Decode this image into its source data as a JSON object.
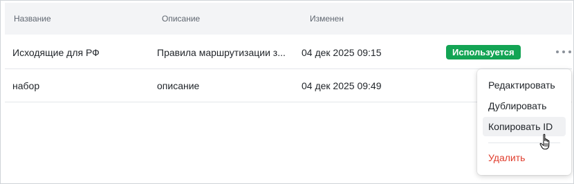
{
  "table": {
    "columns": [
      "Название",
      "Описание",
      "Изменен"
    ],
    "rows": [
      {
        "name": "Исходящие для РФ",
        "description": "Правила маршрутизации з...",
        "modified": "04 дек 2025 09:15",
        "status": "Используется"
      },
      {
        "name": "набор",
        "description": "описание",
        "modified": "04 дек 2025 09:49",
        "status": ""
      }
    ]
  },
  "context_menu": {
    "items": [
      "Редактировать",
      "Дублировать",
      "Копировать ID",
      "Удалить"
    ],
    "hovered_item": "Копировать ID"
  },
  "colors": {
    "status_badge": "#13a454",
    "danger": "#e03b2b",
    "header_bg": "#f3f4f6"
  },
  "icons": {
    "row_actions": "more-horizontal-icon",
    "cursor": "hand-pointer-icon"
  }
}
